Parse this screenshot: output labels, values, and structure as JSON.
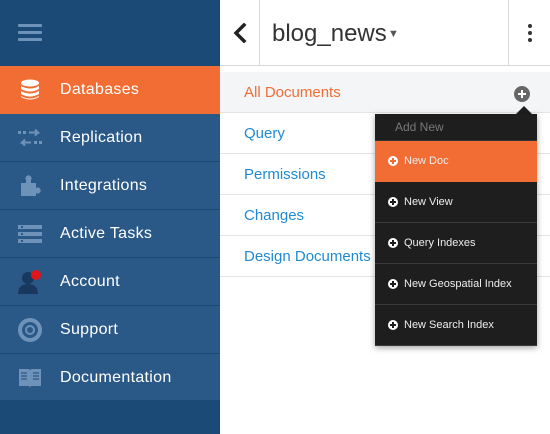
{
  "sidebar": {
    "items": [
      {
        "label": "Databases",
        "icon": "database-icon",
        "active": true
      },
      {
        "label": "Replication",
        "icon": "replication-icon"
      },
      {
        "label": "Integrations",
        "icon": "puzzle-icon"
      },
      {
        "label": "Active Tasks",
        "icon": "tasks-icon"
      },
      {
        "label": "Account",
        "icon": "user-icon"
      },
      {
        "label": "Support",
        "icon": "lifebuoy-icon"
      },
      {
        "label": "Documentation",
        "icon": "book-icon"
      }
    ]
  },
  "header": {
    "db_name": "blog_news",
    "caret": "▼"
  },
  "docs": {
    "items": [
      "All Documents",
      "Query",
      "Permissions",
      "Changes",
      "Design Documents"
    ]
  },
  "dropdown": {
    "header": "Add New",
    "items": [
      "New Doc",
      "New View",
      "Query Indexes",
      "New Geospatial Index",
      "New Search Index"
    ]
  },
  "colors": {
    "accent": "#f26d33",
    "sidebar": "#2a5887",
    "link": "#1f8ad1"
  }
}
